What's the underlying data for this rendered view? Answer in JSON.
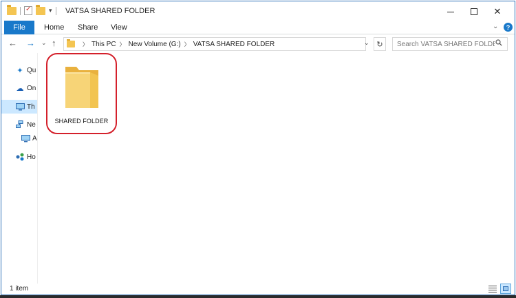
{
  "window": {
    "title": "VATSA SHARED FOLDER"
  },
  "ribbon": {
    "tabs": [
      {
        "label": "File"
      },
      {
        "label": "Home"
      },
      {
        "label": "Share"
      },
      {
        "label": "View"
      }
    ]
  },
  "address": {
    "crumbs": [
      "This PC",
      "New Volume (G:)",
      "VATSA SHARED FOLDER"
    ]
  },
  "search": {
    "placeholder": "Search VATSA SHARED FOLDER"
  },
  "navpane": {
    "items": [
      {
        "label": "Qu",
        "icon": "pin-icon"
      },
      {
        "label": "On",
        "icon": "cloud-icon"
      },
      {
        "label": "Th",
        "icon": "computer-icon"
      },
      {
        "label": "Ne",
        "icon": "network-icon"
      },
      {
        "label": "A",
        "icon": "computer-icon"
      },
      {
        "label": "Ho",
        "icon": "homegroup-icon"
      }
    ]
  },
  "content": {
    "items": [
      {
        "name": "SHARED FOLDER",
        "icon": "folder-icon"
      }
    ]
  },
  "statusbar": {
    "count": "1 item"
  },
  "colors": {
    "accent": "#1979ca",
    "highlight": "#d4202b",
    "folder": "#f4c552"
  }
}
